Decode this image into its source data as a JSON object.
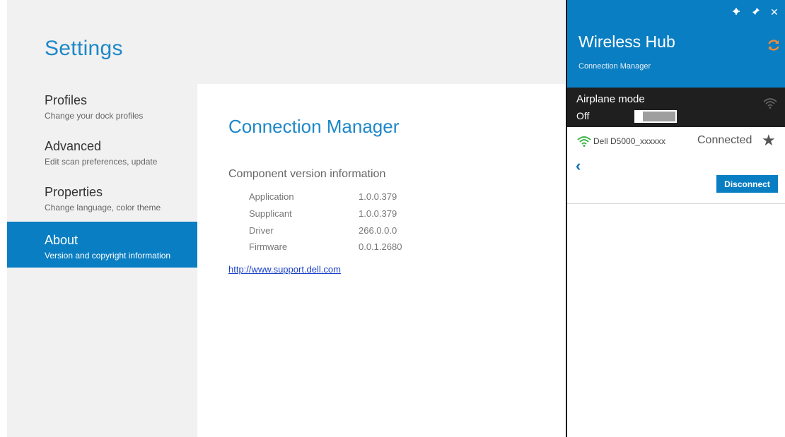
{
  "settings": {
    "title": "Settings",
    "nav": [
      {
        "title": "Profiles",
        "subtitle": "Change your dock profiles"
      },
      {
        "title": "Advanced",
        "subtitle": "Edit scan preferences, update"
      },
      {
        "title": "Properties",
        "subtitle": "Change language, color theme"
      },
      {
        "title": "About",
        "subtitle": "Version and copyright information"
      }
    ],
    "active_nav": "About"
  },
  "content": {
    "heading": "Connection Manager",
    "version_heading": "Component version information",
    "versions": [
      {
        "label": "Application",
        "value": "1.0.0.379"
      },
      {
        "label": "Supplicant",
        "value": "1.0.0.379"
      },
      {
        "label": "Driver",
        "value": "266.0.0.0"
      },
      {
        "label": "Firmware",
        "value": "0.0.1.2680"
      }
    ],
    "support_link": "http://www.support.dell.com"
  },
  "hub": {
    "title": "Wireless Hub",
    "subtitle": "Connection Manager",
    "header_icons": {
      "settings": "gear-icon",
      "pin": "pin-icon",
      "close": "close-icon"
    },
    "airplane_label": "Airplane mode",
    "airplane_state": "Off",
    "network": {
      "name": "Dell D5000_xxxxxx",
      "status": "Connected"
    },
    "disconnect_label": "Disconnect"
  },
  "colors": {
    "accent": "#0a7ec2",
    "title_blue": "#1e88c8",
    "refresh_orange": "#f08a3a",
    "wifi_green": "#3cb44a",
    "airplane_bar": "#1f1f1f"
  }
}
